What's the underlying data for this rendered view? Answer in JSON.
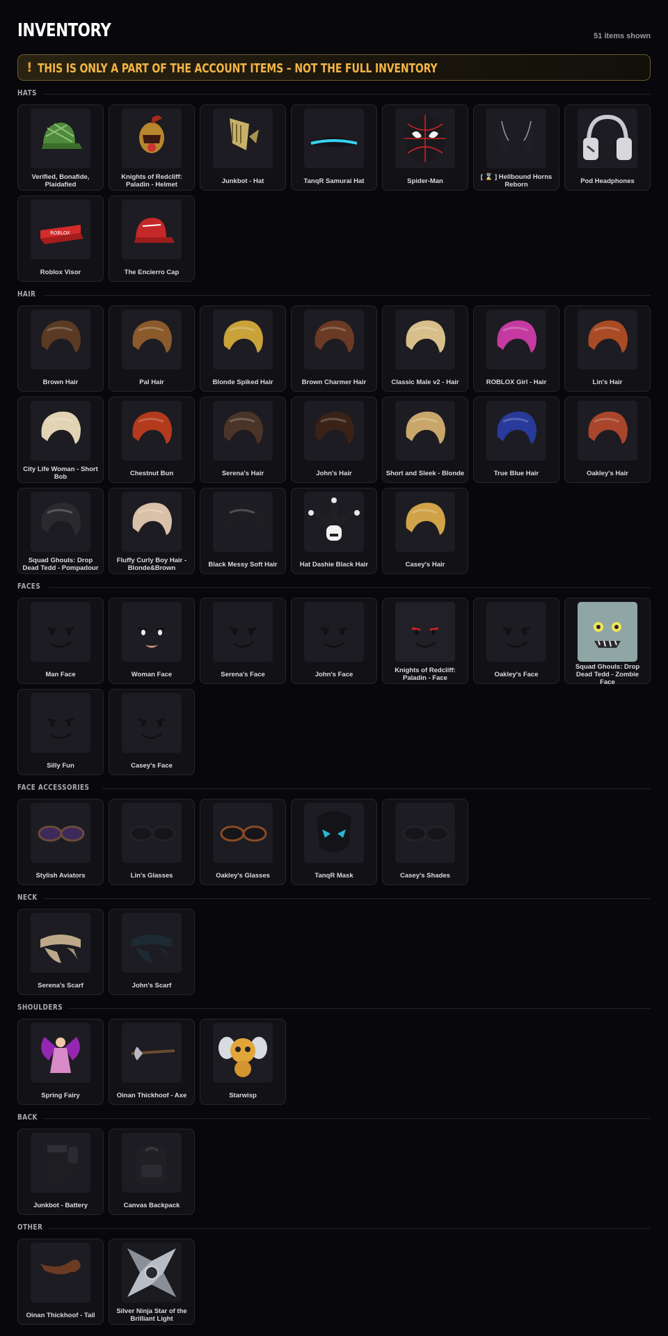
{
  "header": {
    "title": "INVENTORY",
    "count": "51 items shown"
  },
  "notice": {
    "icon": "exclamation-icon",
    "text": "THIS IS ONLY A PART OF THE ACCOUNT ITEMS – NOT THE FULL INVENTORY"
  },
  "sections": [
    {
      "label": "HATS",
      "items": [
        {
          "name": "Verified, Bonafide, Plaidafied",
          "icon": "green-plaid-cap-icon"
        },
        {
          "name": "Knights of Redcliff: Paladin - Helmet",
          "icon": "knight-helmet-icon"
        },
        {
          "name": "Junkbot - Hat",
          "icon": "junkbot-hat-icon"
        },
        {
          "name": "TanqR Samurai Hat",
          "icon": "samurai-hat-icon"
        },
        {
          "name": "Spider-Man",
          "icon": "spider-mask-icon"
        },
        {
          "name": "[ ⌛ ] Hellbound Horns Reborn",
          "icon": "horns-icon"
        },
        {
          "name": "Pod Headphones",
          "icon": "headphones-icon"
        },
        {
          "name": "Roblox Visor",
          "icon": "red-visor-icon"
        },
        {
          "name": "The Encierro Cap",
          "icon": "red-cap-icon"
        }
      ]
    },
    {
      "label": "HAIR",
      "items": [
        {
          "name": "Brown Hair",
          "icon": "hair-icon"
        },
        {
          "name": "Pal Hair",
          "icon": "hair-icon"
        },
        {
          "name": "Blonde Spiked Hair",
          "icon": "hair-icon"
        },
        {
          "name": "Brown Charmer Hair",
          "icon": "hair-icon"
        },
        {
          "name": "Classic Male v2 - Hair",
          "icon": "hair-icon"
        },
        {
          "name": "ROBLOX Girl - Hair",
          "icon": "hair-icon"
        },
        {
          "name": "Lin's Hair",
          "icon": "hair-icon"
        },
        {
          "name": "City Life Woman - Short Bob",
          "icon": "hair-icon"
        },
        {
          "name": "Chestnut Bun",
          "icon": "hair-icon"
        },
        {
          "name": "Serena's Hair",
          "icon": "hair-icon"
        },
        {
          "name": "John's Hair",
          "icon": "hair-icon"
        },
        {
          "name": "Short and Sleek - Blonde",
          "icon": "hair-icon"
        },
        {
          "name": "True Blue Hair",
          "icon": "hair-icon"
        },
        {
          "name": "Oakley's Hair",
          "icon": "hair-icon"
        },
        {
          "name": "Squad Ghouls: Drop Dead Tedd - Pompadour",
          "icon": "hair-icon"
        },
        {
          "name": "Fluffy Curly Boy Hair - Blonde&Brown",
          "icon": "hair-icon"
        },
        {
          "name": "Black Messy Soft Hair",
          "icon": "hair-icon"
        },
        {
          "name": "Hat Dashie Black Hair",
          "icon": "jester-hat-icon"
        },
        {
          "name": "Casey's Hair",
          "icon": "hair-icon"
        }
      ]
    },
    {
      "label": "FACES",
      "items": [
        {
          "name": "Man Face",
          "icon": "face-icon"
        },
        {
          "name": "Woman Face",
          "icon": "face-icon"
        },
        {
          "name": "Serena's Face",
          "icon": "face-icon"
        },
        {
          "name": "John's Face",
          "icon": "face-icon"
        },
        {
          "name": "Knights of Redcliff: Paladin - Face",
          "icon": "face-icon"
        },
        {
          "name": "Oakley's Face",
          "icon": "face-icon"
        },
        {
          "name": "Squad Ghouls: Drop Dead Tedd - Zombie Face",
          "icon": "zombie-face-icon"
        },
        {
          "name": "Silly Fun",
          "icon": "face-icon"
        },
        {
          "name": "Casey's Face",
          "icon": "face-icon"
        }
      ]
    },
    {
      "label": "FACE ACCESSORIES",
      "items": [
        {
          "name": "Stylish Aviators",
          "icon": "glasses-icon"
        },
        {
          "name": "Lin's Glasses",
          "icon": "glasses-icon"
        },
        {
          "name": "Oakley's Glasses",
          "icon": "glasses-icon"
        },
        {
          "name": "TanqR Mask",
          "icon": "mask-icon"
        },
        {
          "name": "Casey's Shades",
          "icon": "glasses-icon"
        }
      ]
    },
    {
      "label": "NECK",
      "items": [
        {
          "name": "Serena's Scarf",
          "icon": "scarf-icon"
        },
        {
          "name": "John's Scarf",
          "icon": "scarf-icon"
        }
      ]
    },
    {
      "label": "SHOULDERS",
      "items": [
        {
          "name": "Spring Fairy",
          "icon": "fairy-icon"
        },
        {
          "name": "Oinan Thickhoof - Axe",
          "icon": "axe-icon"
        },
        {
          "name": "Starwisp",
          "icon": "bee-plush-icon"
        }
      ]
    },
    {
      "label": "BACK",
      "items": [
        {
          "name": "Junkbot - Battery",
          "icon": "battery-pack-icon"
        },
        {
          "name": "Canvas Backpack",
          "icon": "backpack-icon"
        }
      ]
    },
    {
      "label": "OTHER",
      "items": [
        {
          "name": "Oinan Thickhoof - Tail",
          "icon": "tail-icon"
        },
        {
          "name": "Silver Ninja Star of the Brilliant Light",
          "icon": "ninja-star-icon"
        }
      ]
    }
  ]
}
